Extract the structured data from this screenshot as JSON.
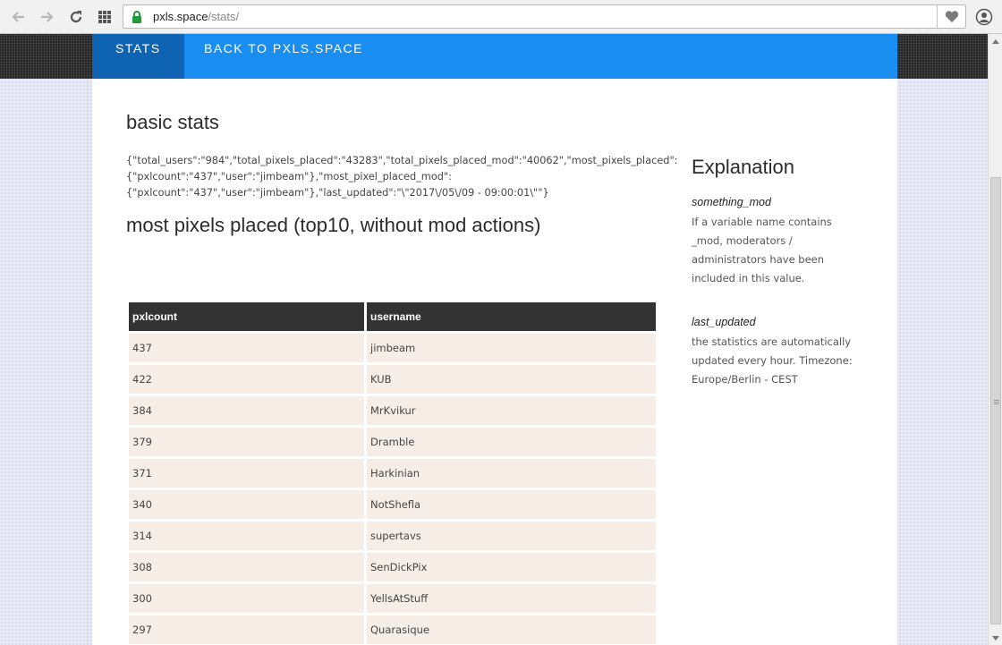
{
  "browser": {
    "url_host": "pxls.space",
    "url_path": "/stats/"
  },
  "nav": {
    "items": [
      {
        "label": "STATS",
        "active": true
      },
      {
        "label": "BACK TO PXLS.SPACE",
        "active": false
      }
    ]
  },
  "main": {
    "basic_heading": "basic stats",
    "json_lines": [
      "{\"total_users\":\"984\",\"total_pixels_placed\":\"43283\",\"total_pixels_placed_mod\":\"40062\",\"most_pixels_placed\":",
      "{\"pxlcount\":\"437\",\"user\":\"jimbeam\"},\"most_pixel_placed_mod\":",
      "{\"pxlcount\":\"437\",\"user\":\"jimbeam\"},\"last_updated\":\"\\\"2017\\/05\\/09 - 09:00:01\\\"\"}"
    ],
    "table_heading": "most pixels placed (top10, without mod actions)",
    "table": {
      "columns": [
        "pxlcount",
        "username"
      ],
      "rows": [
        [
          "437",
          "jimbeam"
        ],
        [
          "422",
          "KUB"
        ],
        [
          "384",
          "MrKvikur"
        ],
        [
          "379",
          "Dramble"
        ],
        [
          "371",
          "Harkinian"
        ],
        [
          "340",
          "NotShefla"
        ],
        [
          "314",
          "supertavs"
        ],
        [
          "308",
          "SenDickPix"
        ],
        [
          "300",
          "YellsAtStuff"
        ],
        [
          "297",
          "Quarasique"
        ]
      ]
    }
  },
  "aside": {
    "title": "Explanation",
    "terms": [
      {
        "term": "something_mod",
        "desc_lines": [
          "If a variable name contains",
          "_mod, moderators /",
          "administrators have been",
          "included in this value."
        ]
      },
      {
        "term": "last_updated",
        "desc_lines": [
          "the statistics are automatically",
          "updated every hour. Timezone:",
          "Europe/Berlin - CEST"
        ]
      }
    ]
  }
}
